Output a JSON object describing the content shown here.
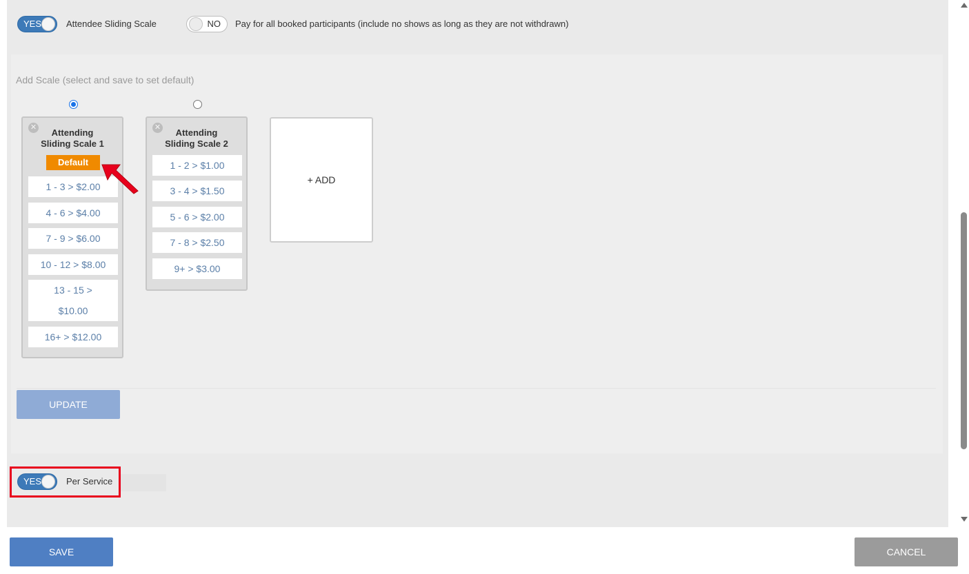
{
  "top_bar": {
    "sliding_scale_toggle": {
      "state": "YES",
      "label": "Attendee Sliding Scale"
    },
    "pay_all_toggle": {
      "state": "NO",
      "label": "Pay for all booked participants (include no shows as long as they are not withdrawn)"
    }
  },
  "scale_section": {
    "heading": "Add Scale (select and save to set default)",
    "scales": [
      {
        "title_line1": "Attending",
        "title_line2": "Sliding Scale 1",
        "selected": true,
        "badge": "Default",
        "rows": [
          "1 - 3 > $2.00",
          "4 - 6 > $4.00",
          "7 - 9 > $6.00",
          "10 - 12 > $8.00",
          "13 - 15 >",
          "$10.00",
          "16+ > $12.00"
        ]
      },
      {
        "title_line1": "Attending",
        "title_line2": "Sliding Scale 2",
        "selected": false,
        "rows": [
          "1 - 2 > $1.00",
          "3 - 4 > $1.50",
          "5 - 6 > $2.00",
          "7 - 8 > $2.50",
          "9+ > $3.00"
        ]
      }
    ],
    "add_label": "+ ADD",
    "update_label": "UPDATE"
  },
  "per_service_toggle": {
    "state": "YES",
    "label": "Per Service"
  },
  "footer": {
    "save_label": "SAVE",
    "cancel_label": "CANCEL"
  },
  "colors": {
    "toggle_on": "#3d7ab8",
    "default_badge": "#f08a00",
    "highlight_box": "#e8001c",
    "save": "#4f7fc3",
    "cancel": "#9b9b9b",
    "update": "#8fabd6"
  }
}
